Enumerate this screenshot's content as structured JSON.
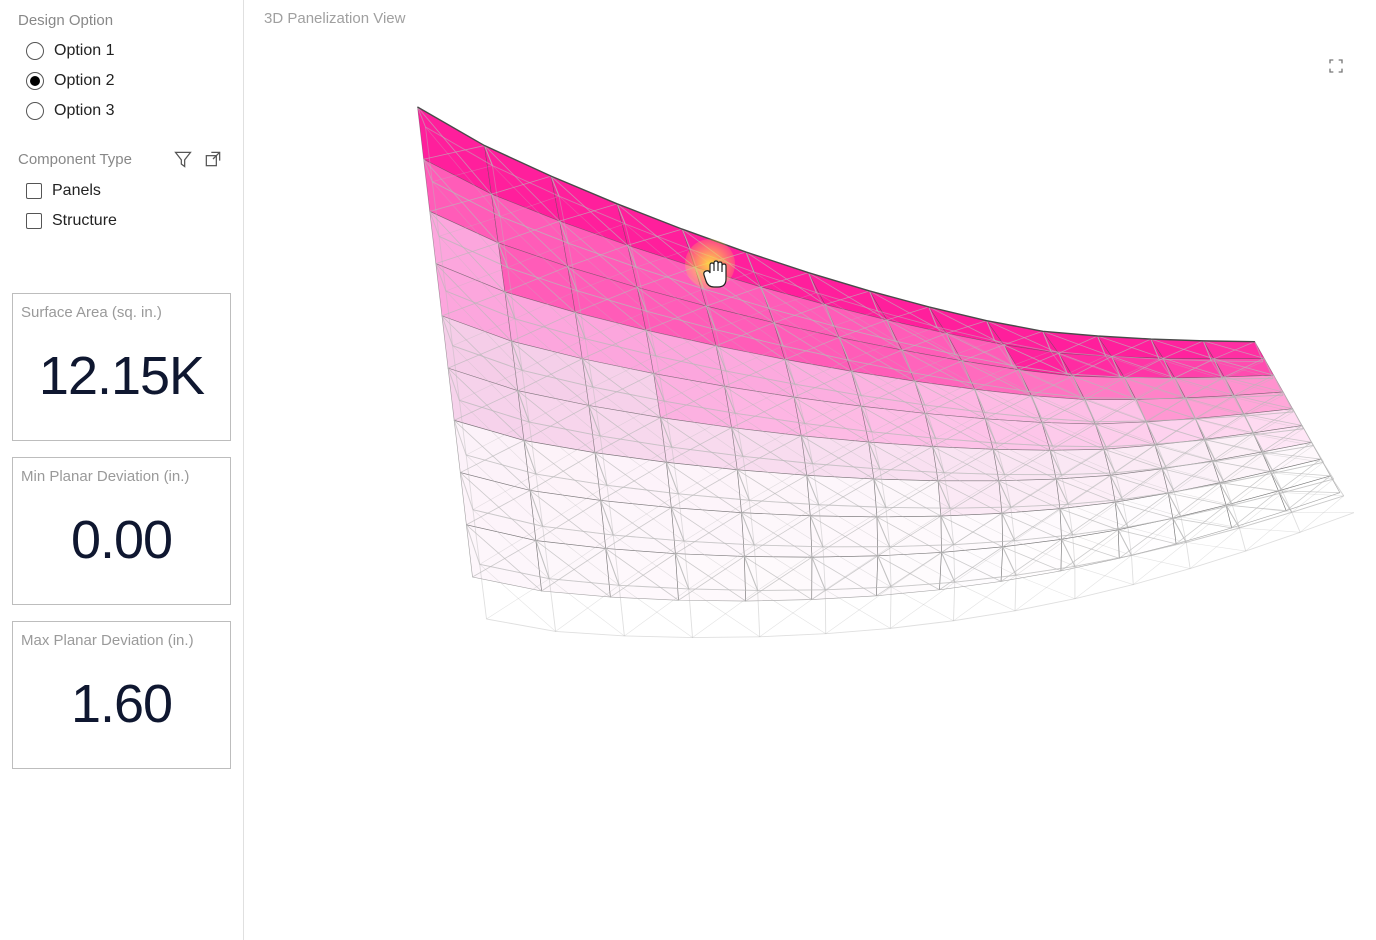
{
  "sidebar": {
    "design_option": {
      "title": "Design Option",
      "options": [
        {
          "label": "Option 1",
          "selected": false
        },
        {
          "label": "Option 2",
          "selected": true
        },
        {
          "label": "Option 3",
          "selected": false
        }
      ]
    },
    "component_type": {
      "title": "Component Type",
      "items": [
        {
          "label": "Panels",
          "checked": false
        },
        {
          "label": "Structure",
          "checked": false
        }
      ],
      "filter_icon": "filter-icon",
      "popout_icon": "popout-icon"
    },
    "metrics": [
      {
        "label": "Surface Area (sq. in.)",
        "value": "12.15K"
      },
      {
        "label": "Min Planar Deviation (in.)",
        "value": "0.00"
      },
      {
        "label": "Max Planar Deviation (in.)",
        "value": "1.60"
      }
    ]
  },
  "main": {
    "title": "3D Panelization View",
    "focus_icon": "focus-mode-icon"
  },
  "viz": {
    "colors": {
      "panel_dark": "#ff1f9c",
      "panel_mid": "#ff5cb8",
      "panel_light": "#fca6dd",
      "panel_pale": "#f5cde8",
      "structure": "#b8b8b8",
      "edge": "#4a4a4a"
    }
  }
}
